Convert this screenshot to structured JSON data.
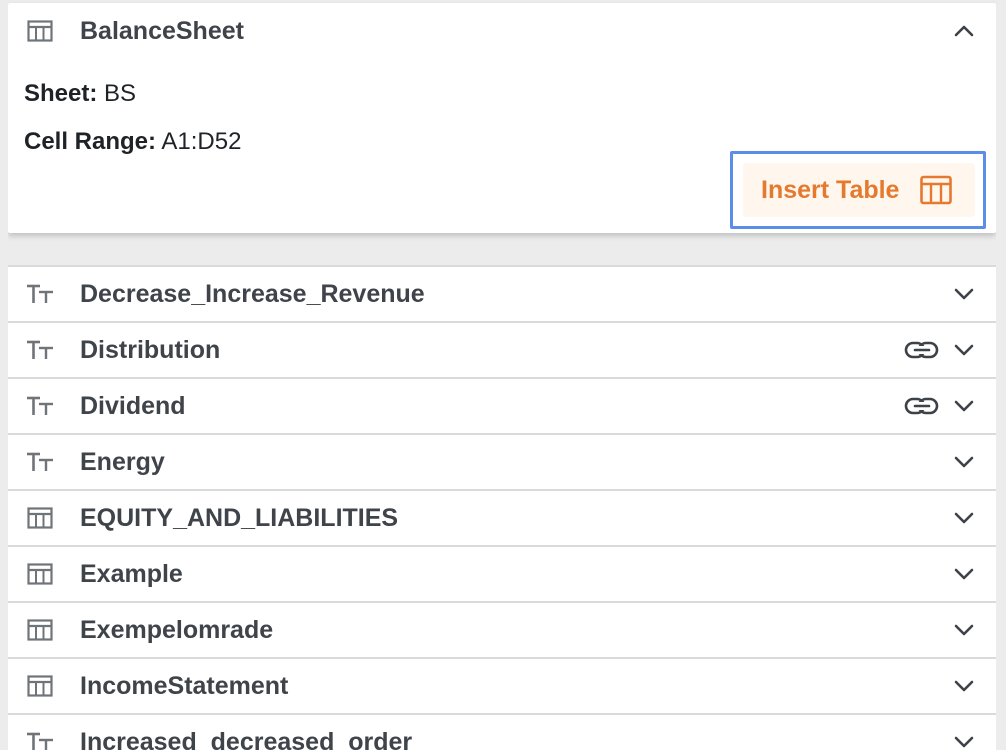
{
  "expanded": {
    "title": "BalanceSheet",
    "type_icon": "table-icon",
    "sheet_label": "Sheet:",
    "sheet_value": "BS",
    "range_label": "Cell Range:",
    "range_value": "A1:D52",
    "insert_label": "Insert Table",
    "insert_icon": "table-icon",
    "collapse_icon": "chevron-up-icon"
  },
  "items": [
    {
      "label": "Decrease_Increase_Revenue",
      "icon": "text-icon",
      "linked": false
    },
    {
      "label": "Distribution",
      "icon": "text-icon",
      "linked": true
    },
    {
      "label": "Dividend",
      "icon": "text-icon",
      "linked": true
    },
    {
      "label": "Energy",
      "icon": "text-icon",
      "linked": false
    },
    {
      "label": "EQUITY_AND_LIABILITIES",
      "icon": "table-icon",
      "linked": false
    },
    {
      "label": "Example",
      "icon": "table-icon",
      "linked": false
    },
    {
      "label": "Exempelomrade",
      "icon": "table-icon",
      "linked": false
    },
    {
      "label": "IncomeStatement",
      "icon": "table-icon",
      "linked": false
    },
    {
      "label": "Increased_decreased_order",
      "icon": "text-icon",
      "linked": false
    }
  ],
  "colors": {
    "accent_orange": "#e57a2e",
    "focus_blue": "#5b8ee6",
    "icon_gray": "#707479",
    "divider": "#dadada"
  }
}
